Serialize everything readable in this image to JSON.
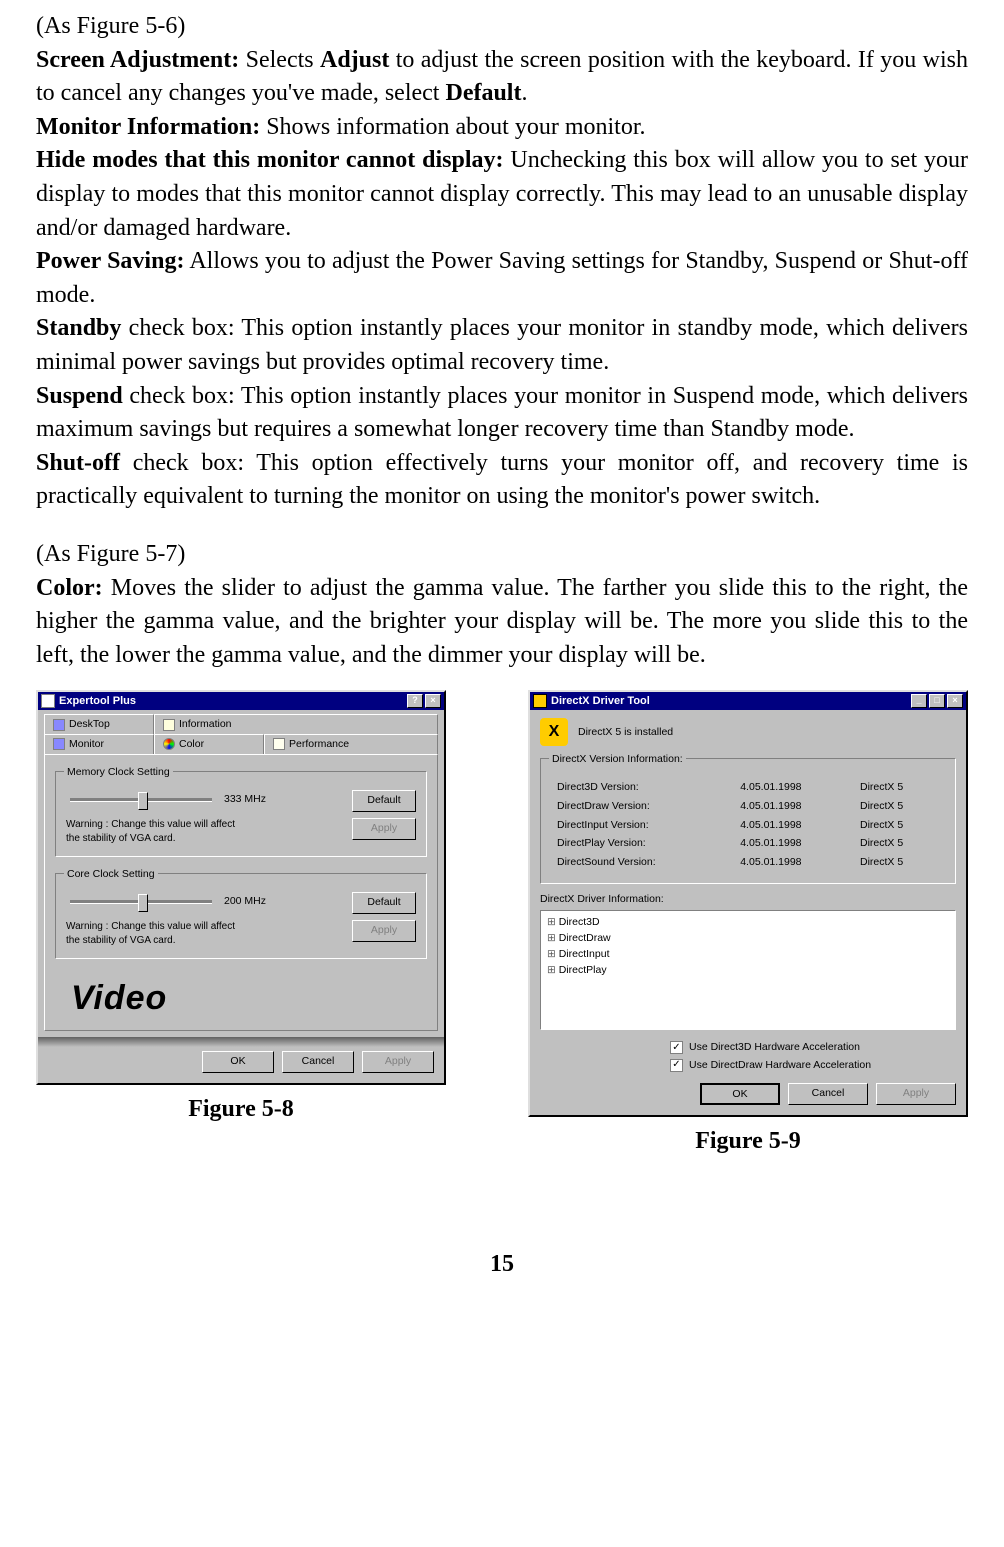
{
  "doc": {
    "fig56_ref": "(As Figure 5-6)",
    "screen_adj_label": "Screen Adjustment:",
    "screen_adj_text_a": " Selects ",
    "screen_adj_bold_adjust": "Adjust",
    "screen_adj_text_b": " to adjust the screen position with the keyboard. If you wish to cancel any changes you've made, select ",
    "screen_adj_bold_default": "Default",
    "screen_adj_text_c": ".",
    "monitor_info_label": "Monitor Information:",
    "monitor_info_text": " Shows information about your monitor.",
    "hide_modes_label": "Hide modes that this monitor cannot display:",
    "hide_modes_text": " Unchecking this box will allow you to set your display to modes that this monitor cannot display correctly.  This may lead to an unusable display and/or damaged hardware.",
    "power_saving_label": "Power Saving:",
    "power_saving_text": " Allows you to adjust the Power Saving settings for Standby, Suspend or Shut-off mode.",
    "standby_label": "Standby",
    "standby_text": " check box: This option instantly places your monitor in standby mode, which delivers minimal power savings but provides optimal recovery time.",
    "suspend_label": "Suspend",
    "suspend_text": " check box: This option instantly places your monitor in Suspend mode, which delivers maximum savings but requires a somewhat longer recovery time than Standby mode.",
    "shutoff_label": "Shut-off",
    "shutoff_text": " check box: This option effectively turns your monitor off, and recovery time is practically equivalent to turning the monitor on using the monitor's power switch.",
    "fig57_ref": "(As Figure 5-7)",
    "color_label": "Color:",
    "color_text": " Moves the slider to adjust the gamma value.  The farther you slide this to the right, the higher the gamma value, and the brighter your display will be.  The more you slide this to the left, the lower the gamma value, and the dimmer your display will be.",
    "caption_58": "Figure 5-8",
    "caption_59": "Figure 5-9",
    "page_number": "15"
  },
  "fig58": {
    "title": "Expertool Plus",
    "tabs": {
      "desktop": "DeskTop",
      "information": "Information",
      "monitor": "Monitor",
      "color": "Color",
      "performance": "Performance"
    },
    "mem_group": "Memory Clock Setting",
    "mem_val": "333 MHz",
    "core_group": "Core Clock Setting",
    "core_val": "200 MHz",
    "default_btn": "Default",
    "apply_btn": "Apply",
    "warning": "Warning : Change this value will affect the stability of VGA card.",
    "logo": "Video",
    "ok": "OK",
    "cancel": "Cancel",
    "apply": "Apply",
    "help_btn": "?",
    "close_btn": "×"
  },
  "fig59": {
    "title": "DirectX Driver Tool",
    "installed": "DirectX 5 is installed",
    "ver_group": "DirectX Version Information:",
    "rows": [
      {
        "name": "Direct3D Version:",
        "ver": "4.05.01.1998",
        "dx": "DirectX 5"
      },
      {
        "name": "DirectDraw Version:",
        "ver": "4.05.01.1998",
        "dx": "DirectX 5"
      },
      {
        "name": "DirectInput Version:",
        "ver": "4.05.01.1998",
        "dx": "DirectX 5"
      },
      {
        "name": "DirectPlay Version:",
        "ver": "4.05.01.1998",
        "dx": "DirectX 5"
      },
      {
        "name": "DirectSound Version:",
        "ver": "4.05.01.1998",
        "dx": "DirectX 5"
      }
    ],
    "drv_group": "DirectX Driver Information:",
    "tree": [
      "Direct3D",
      "DirectDraw",
      "DirectInput",
      "DirectPlay"
    ],
    "chk1": "Use Direct3D Hardware Acceleration",
    "chk2": "Use DirectDraw Hardware Acceleration",
    "ok": "OK",
    "cancel": "Cancel",
    "apply": "Apply",
    "min_btn": "_",
    "max_btn": "□",
    "close_btn": "×"
  }
}
